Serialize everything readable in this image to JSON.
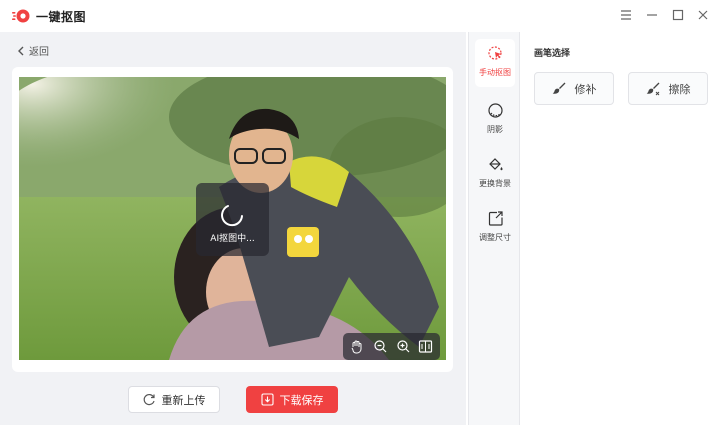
{
  "app": {
    "title": "一键抠图"
  },
  "nav": {
    "back_label": "返回"
  },
  "canvas": {
    "loading_text": "AI抠图中..."
  },
  "actions": {
    "reupload_label": "重新上传",
    "download_label": "下载保存"
  },
  "tools": [
    {
      "label": "手动抠图",
      "icon": "cursor-click-icon",
      "active": true
    },
    {
      "label": "阴影",
      "icon": "shadow-circle-icon",
      "active": false
    },
    {
      "label": "更换背景",
      "icon": "paint-bucket-icon",
      "active": false
    },
    {
      "label": "调整尺寸",
      "icon": "resize-icon",
      "active": false
    }
  ],
  "panel": {
    "title": "画笔选择",
    "brushes": [
      {
        "label": "修补",
        "icon": "brush-icon"
      },
      {
        "label": "擦除",
        "icon": "eraser-brush-icon"
      }
    ]
  },
  "colors": {
    "accent": "#f04141",
    "workarea_bg": "#f1f2f5"
  }
}
